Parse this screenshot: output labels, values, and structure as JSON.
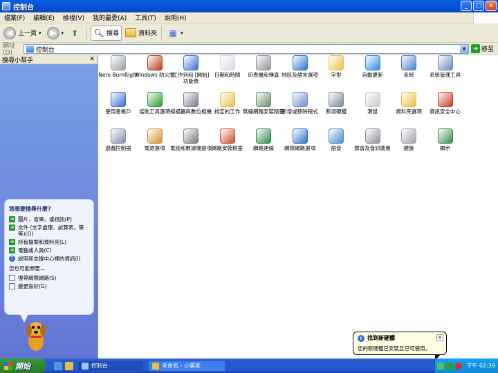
{
  "window": {
    "title": "控制台"
  },
  "menu": [
    "檔案(F)",
    "編輯(E)",
    "檢視(V)",
    "我的最愛(A)",
    "工具(T)",
    "說明(H)"
  ],
  "toolbar": {
    "back": "上一頁",
    "search": "搜尋",
    "folders": "資料夾"
  },
  "address": {
    "label": "網址(D)",
    "value": "控制台",
    "go": "移至"
  },
  "sidepane": {
    "title": "搜尋小幫手",
    "question": "您想要搜尋什麼?",
    "options": [
      "圖片、音樂，或視訊(P)",
      "文件 (文字處理、試算表，等等)(O)",
      "所有檔案和資料夾(L)",
      "電腦或人員(C)"
    ],
    "help": "說明和支援中心裡的資訊(I)",
    "also": "您也可能想要...",
    "links": [
      "搜尋網際網路(S)",
      "變更喜好(G)"
    ]
  },
  "items": [
    {
      "label": "Nero BurnRight",
      "color": "#9aa0a8"
    },
    {
      "label": "Windows 防火牆",
      "color": "#b83818"
    },
    {
      "label": "工作列和 [開始] 功能表",
      "color": "#3a70c8"
    },
    {
      "label": "日期和時間",
      "color": "#d8d8e8"
    },
    {
      "label": "印表機和傳真",
      "color": "#909098"
    },
    {
      "label": "地區及語言選項",
      "color": "#2a70d0"
    },
    {
      "label": "字型",
      "color": "#e8c040"
    },
    {
      "label": "自動更新",
      "color": "#2a8ae0"
    },
    {
      "label": "系統",
      "color": "#4a7ac8"
    },
    {
      "label": "系統管理工具",
      "color": "#6a8ac0"
    },
    {
      "label": "使用者帳戶",
      "color": "#3a6ad8"
    },
    {
      "label": "協助工具選項",
      "color": "#2a9a2a"
    },
    {
      "label": "掃描器與數位相機",
      "color": "#7a7a88"
    },
    {
      "label": "排定的工作",
      "color": "#e8c040"
    },
    {
      "label": "無線網路安裝精靈",
      "color": "#6a8a6a"
    },
    {
      "label": "新增或移除程式",
      "color": "#6a8ad0"
    },
    {
      "label": "新增硬體",
      "color": "#7a8a98"
    },
    {
      "label": "滑鼠",
      "color": "#c8c8d0"
    },
    {
      "label": "資料夾選項",
      "color": "#e8c040"
    },
    {
      "label": "資訊安全中心",
      "color": "#c83820"
    },
    {
      "label": "遊戲控制器",
      "color": "#8090a8"
    },
    {
      "label": "電源選項",
      "color": "#d09030"
    },
    {
      "label": "電話和數據機選項",
      "color": "#7a7a80"
    },
    {
      "label": "網路安裝精靈",
      "color": "#c85030"
    },
    {
      "label": "網路連線",
      "color": "#2a8a4a"
    },
    {
      "label": "網際網路選項",
      "color": "#2a70c0"
    },
    {
      "label": "語音",
      "color": "#4a8ad0"
    },
    {
      "label": "聲音及音訊裝置",
      "color": "#909098"
    },
    {
      "label": "鍵盤",
      "color": "#a0a0a8"
    },
    {
      "label": "顯示",
      "color": "#3a8a4a"
    }
  ],
  "balloon": {
    "title": "找到新硬體",
    "text": "您的新硬體已安裝且已可使用。"
  },
  "taskbar": {
    "start": "開始",
    "tasks": [
      "控制台",
      "未命名 - 小畫家"
    ],
    "clock": "下午 02:39"
  }
}
